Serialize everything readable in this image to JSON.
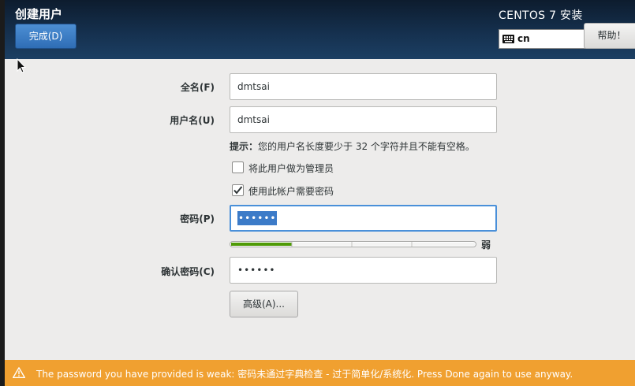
{
  "header": {
    "title": "创建用户",
    "done_label": "完成(D)",
    "product": "CENTOS 7 安装",
    "keyboard_layout": "cn",
    "help_label": "帮助！"
  },
  "form": {
    "fullname_label": "全名(F)",
    "fullname_value": "dmtsai",
    "username_label": "用户名(U)",
    "username_value": "dmtsai",
    "hint_bold": "提示：",
    "hint_text": "您的用户名长度要少于 32 个字符并且不能有空格。",
    "admin_checkbox_label": "将此用户做为管理员",
    "admin_checked": false,
    "require_password_label": "使用此帐户需要密码",
    "require_password_checked": true,
    "password_label": "密码(P)",
    "password_masked": "••••••",
    "strength_fraction": 0.25,
    "strength_label": "弱",
    "confirm_label": "确认密码(C)",
    "confirm_masked": "••••••",
    "advanced_label": "高级(A)..."
  },
  "warning": {
    "text": "The password you have provided is weak: 密码未通过字典检查 - 过于简单化/系统化. Press Done again to use anyway."
  },
  "colors": {
    "header_dark": "#0d1c2e",
    "accent_blue": "#2f6db5",
    "strength_green": "#4e9a06",
    "warning_orange": "#f0a030"
  }
}
